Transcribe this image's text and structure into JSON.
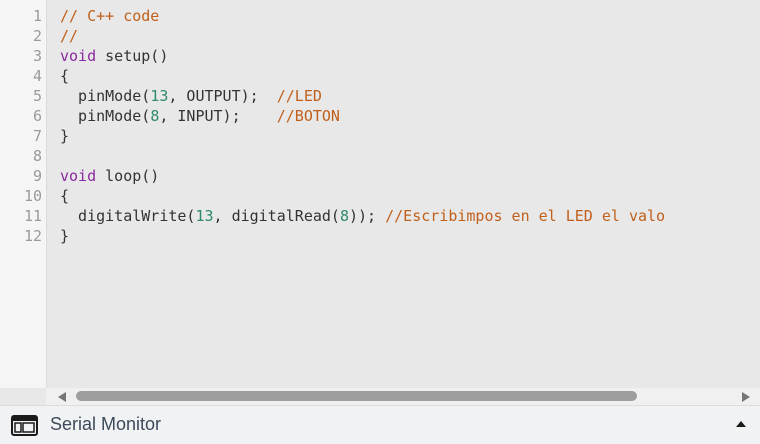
{
  "editor": {
    "line_numbers": [
      "1",
      "2",
      "3",
      "4",
      "5",
      "6",
      "7",
      "8",
      "9",
      "10",
      "11",
      "12"
    ],
    "lines": [
      [
        {
          "t": "cm",
          "v": "// C++ code"
        }
      ],
      [
        {
          "t": "cm",
          "v": "//"
        }
      ],
      [
        {
          "t": "kw",
          "v": "void"
        },
        {
          "t": "fn",
          "v": " setup()"
        }
      ],
      [
        {
          "t": "fn",
          "v": "{"
        }
      ],
      [
        {
          "t": "fn",
          "v": "  pinMode("
        },
        {
          "t": "num",
          "v": "13"
        },
        {
          "t": "fn",
          "v": ", OUTPUT);  "
        },
        {
          "t": "cm",
          "v": "//LED"
        }
      ],
      [
        {
          "t": "fn",
          "v": "  pinMode("
        },
        {
          "t": "num",
          "v": "8"
        },
        {
          "t": "fn",
          "v": ", INPUT);    "
        },
        {
          "t": "cm",
          "v": "//BOTON"
        }
      ],
      [
        {
          "t": "fn",
          "v": "}"
        }
      ],
      [
        {
          "t": "fn",
          "v": ""
        }
      ],
      [
        {
          "t": "kw",
          "v": "void"
        },
        {
          "t": "fn",
          "v": " loop()"
        }
      ],
      [
        {
          "t": "fn",
          "v": "{"
        }
      ],
      [
        {
          "t": "fn",
          "v": "  digitalWrite("
        },
        {
          "t": "num",
          "v": "13"
        },
        {
          "t": "fn",
          "v": ", digitalRead("
        },
        {
          "t": "num",
          "v": "8"
        },
        {
          "t": "fn",
          "v": ")); "
        },
        {
          "t": "cm",
          "v": "//Escribimpos en el LED el valo"
        }
      ],
      [
        {
          "t": "fn",
          "v": "}"
        }
      ]
    ]
  },
  "scrollbar": {
    "left_icon": "scroll-left-arrow-icon",
    "right_icon": "scroll-right-arrow-icon"
  },
  "serial_monitor": {
    "label": "Serial Monitor",
    "icon": "serial-monitor-window-icon",
    "toggle_icon": "caret-up-icon"
  },
  "colors": {
    "keyword": "#8a2aa0",
    "number": "#2e8b6a",
    "comment": "#c0601b",
    "text": "#333333",
    "editor_bg": "#e8e8e8"
  }
}
